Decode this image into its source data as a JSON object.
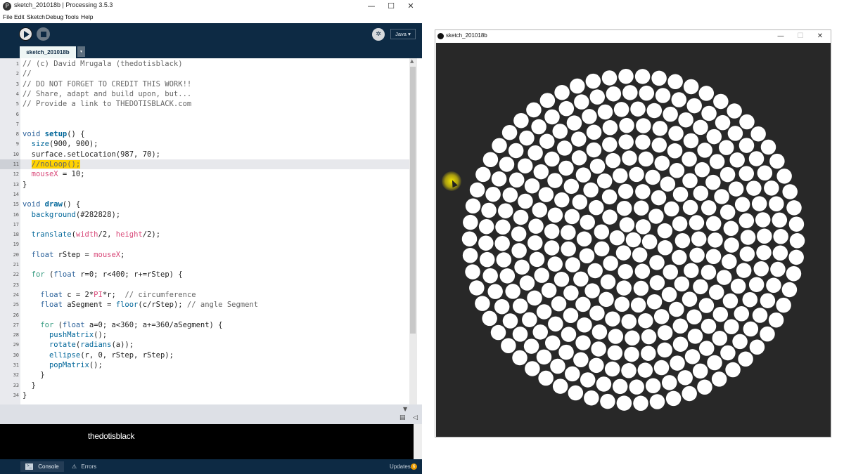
{
  "ide": {
    "title": "sketch_201018b | Processing 3.5.3",
    "app_icon": "processing-logo-icon",
    "window_controls": [
      "—",
      "☐",
      "✕"
    ],
    "menu": [
      "File",
      "Edit",
      "Sketch",
      "Debug",
      "Tools",
      "Help"
    ],
    "mode": "Java ▾",
    "tab_label": "sketch_201018b",
    "tab_menu": "▾",
    "code_lines": [
      "1",
      "2",
      "3",
      "4",
      "5",
      "6",
      "7",
      "8",
      "9",
      "10",
      "11",
      "12",
      "13",
      "14",
      "15",
      "16",
      "17",
      "18",
      "19",
      "20",
      "21",
      "22",
      "23",
      "24",
      "25",
      "26",
      "27",
      "28",
      "29",
      "30",
      "31",
      "32",
      "33",
      "34"
    ],
    "code": {
      "l1": "// (c) David Mrugala (thedotisblack)",
      "l2": "//",
      "l3": "// DO NOT FORGET TO CREDIT THIS WORK!!",
      "l4": "// Share, adapt and build upon, but...",
      "l5": "// Provide a link to THEDOTISBLACK.com",
      "void": "void",
      "setup": "setup",
      "draw": "draw",
      "size": "size",
      "size_args": "(900, 900);",
      "surface": "surface.setLocation(987, 70);",
      "noloop": "//noLoop();",
      "mousex": "mouseX",
      "mousex_assign": " = 10;",
      "background": "background",
      "background_args": "(#282828);",
      "translate": "translate",
      "width": "width",
      "height": "height",
      "float": "float",
      "for": "for",
      "floor": "floor",
      "pushmatrix": "pushMatrix",
      "rotate": "rotate",
      "radians": "radians",
      "ellipse": "ellipse",
      "popmatrix": "popMatrix",
      "pi": "PI",
      "comment_circ": "// circumference",
      "comment_seg": "// angle Segment"
    },
    "console_output": "thedotisblack",
    "console_label": "Console",
    "errors_label": "Errors",
    "updates_label": "Updates",
    "updates_count": "6"
  },
  "sketch": {
    "title": "sketch_201018b",
    "window_controls": [
      "—",
      "☐",
      "✕"
    ],
    "background_color": "#282828",
    "dot_color": "#ffffff"
  }
}
